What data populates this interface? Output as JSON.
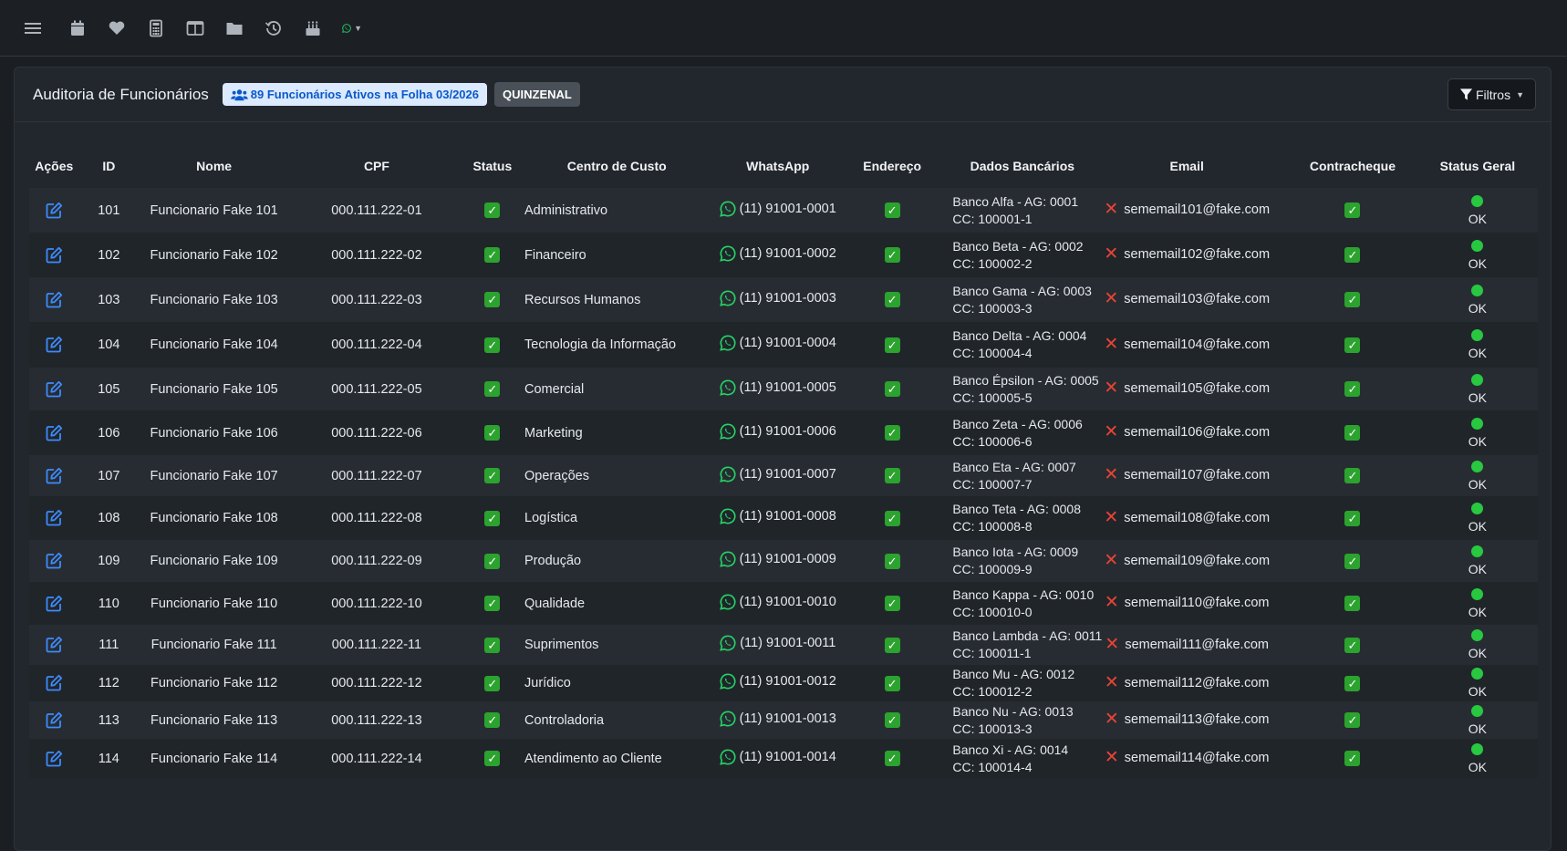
{
  "topbar": {
    "icons": [
      "menu-icon",
      "calendar-icon",
      "heart-icon",
      "calculator-icon",
      "columns-icon",
      "folder-icon",
      "history-icon",
      "birthday-cake-icon",
      "whatsapp-icon"
    ]
  },
  "header": {
    "title": "Auditoria de Funcionários",
    "badge_active": "89 Funcionários Ativos na Folha 03/2026",
    "badge_period": "QUINZENAL",
    "filter_label": "Filtros"
  },
  "colors": {
    "accent_blue": "#3d8bfd",
    "success_green": "#2ba32e",
    "whatsapp_green": "#25d366",
    "danger_red": "#ea4335"
  },
  "table": {
    "columns": [
      "Ações",
      "ID",
      "Nome",
      "CPF",
      "Status",
      "Centro de Custo",
      "WhatsApp",
      "Endereço",
      "Dados Bancários",
      "Email",
      "Contracheque",
      "Status Geral"
    ],
    "rows": [
      {
        "id": "101",
        "name": "Funcionario Fake 101",
        "cpf": "000.111.222-01",
        "cc": "Administrativo",
        "wa": "(11) 91001-0001",
        "bank1": "Banco Alfa - AG: 0001",
        "bank2": "CC: 100001-1",
        "email": "sememail101@fake.com",
        "geral": "OK"
      },
      {
        "id": "102",
        "name": "Funcionario Fake 102",
        "cpf": "000.111.222-02",
        "cc": "Financeiro",
        "wa": "(11) 91001-0002",
        "bank1": "Banco Beta - AG: 0002",
        "bank2": "CC: 100002-2",
        "email": "sememail102@fake.com",
        "geral": "OK"
      },
      {
        "id": "103",
        "name": "Funcionario Fake 103",
        "cpf": "000.111.222-03",
        "cc": "Recursos Humanos",
        "wa": "(11) 91001-0003",
        "bank1": "Banco Gama - AG: 0003",
        "bank2": "CC: 100003-3",
        "email": "sememail103@fake.com",
        "geral": "OK"
      },
      {
        "id": "104",
        "name": "Funcionario Fake 104",
        "cpf": "000.111.222-04",
        "cc": "Tecnologia da Informação",
        "wa": "(11) 91001-0004",
        "bank1": "Banco Delta - AG: 0004",
        "bank2": "CC: 100004-4",
        "email": "sememail104@fake.com",
        "geral": "OK"
      },
      {
        "id": "105",
        "name": "Funcionario Fake 105",
        "cpf": "000.111.222-05",
        "cc": "Comercial",
        "wa": "(11) 91001-0005",
        "bank1": "Banco Épsilon - AG: 0005",
        "bank2": "CC: 100005-5",
        "email": "sememail105@fake.com",
        "geral": "OK"
      },
      {
        "id": "106",
        "name": "Funcionario Fake 106",
        "cpf": "000.111.222-06",
        "cc": "Marketing",
        "wa": "(11) 91001-0006",
        "bank1": "Banco Zeta - AG: 0006",
        "bank2": "CC: 100006-6",
        "email": "sememail106@fake.com",
        "geral": "OK"
      },
      {
        "id": "107",
        "name": "Funcionario Fake 107",
        "cpf": "000.111.222-07",
        "cc": "Operações",
        "wa": "(11) 91001-0007",
        "bank1": "Banco Eta - AG: 0007",
        "bank2": "CC: 100007-7",
        "email": "sememail107@fake.com",
        "geral": "OK"
      },
      {
        "id": "108",
        "name": "Funcionario Fake 108",
        "cpf": "000.111.222-08",
        "cc": "Logística",
        "wa": "(11) 91001-0008",
        "bank1": "Banco Teta - AG: 0008",
        "bank2": "CC: 100008-8",
        "email": "sememail108@fake.com",
        "geral": "OK"
      },
      {
        "id": "109",
        "name": "Funcionario Fake 109",
        "cpf": "000.111.222-09",
        "cc": "Produção",
        "wa": "(11) 91001-0009",
        "bank1": "Banco Iota - AG: 0009",
        "bank2": "CC: 100009-9",
        "email": "sememail109@fake.com",
        "geral": "OK"
      },
      {
        "id": "110",
        "name": "Funcionario Fake 110",
        "cpf": "000.111.222-10",
        "cc": "Qualidade",
        "wa": "(11) 91001-0010",
        "bank1": "Banco Kappa - AG: 0010",
        "bank2": "CC: 100010-0",
        "email": "sememail110@fake.com",
        "geral": "OK"
      },
      {
        "id": "111",
        "name": "Funcionario Fake 111",
        "cpf": "000.111.222-11",
        "cc": "Suprimentos",
        "wa": "(11) 91001-0011",
        "bank1": "Banco Lambda - AG: 0011",
        "bank2": "CC: 100011-1",
        "email": "sememail111@fake.com",
        "geral": "OK"
      },
      {
        "id": "112",
        "name": "Funcionario Fake 112",
        "cpf": "000.111.222-12",
        "cc": "Jurídico",
        "wa": "(11) 91001-0012",
        "bank1": "Banco Mu - AG: 0012",
        "bank2": "CC: 100012-2",
        "email": "sememail112@fake.com",
        "geral": "OK"
      },
      {
        "id": "113",
        "name": "Funcionario Fake 113",
        "cpf": "000.111.222-13",
        "cc": "Controladoria",
        "wa": "(11) 91001-0013",
        "bank1": "Banco Nu - AG: 0013",
        "bank2": "CC: 100013-3",
        "email": "sememail113@fake.com",
        "geral": "OK"
      },
      {
        "id": "114",
        "name": "Funcionario Fake 114",
        "cpf": "000.111.222-14",
        "cc": "Atendimento ao Cliente",
        "wa": "(11) 91001-0014",
        "bank1": "Banco Xi - AG: 0014",
        "bank2": "CC: 100014-4",
        "email": "sememail114@fake.com",
        "geral": "OK"
      }
    ]
  }
}
